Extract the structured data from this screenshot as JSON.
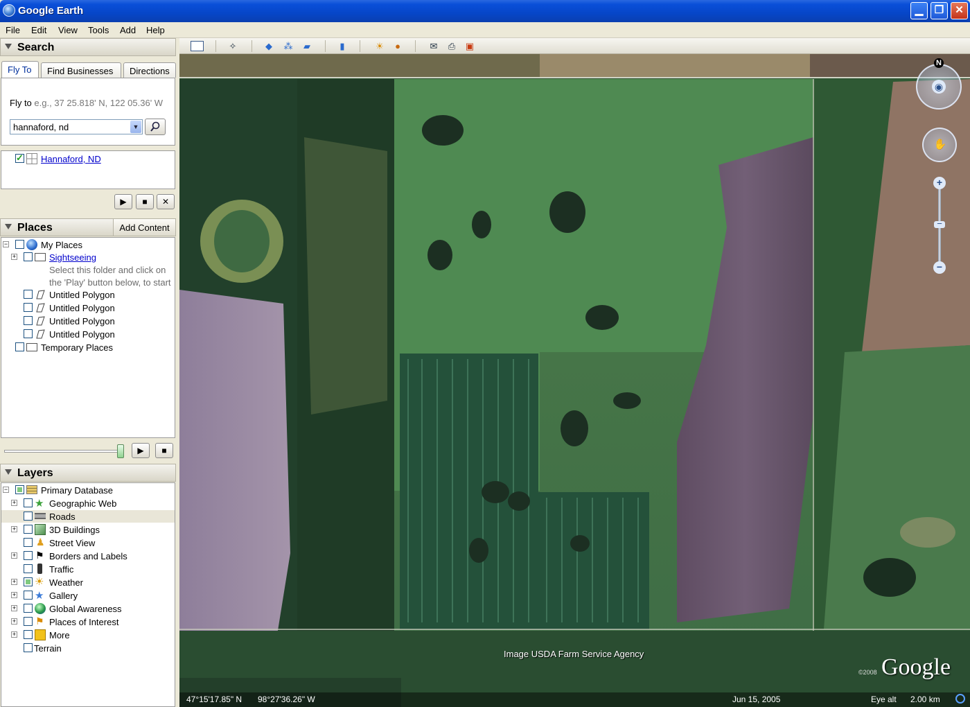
{
  "window": {
    "title": "Google Earth"
  },
  "menu": [
    "File",
    "Edit",
    "View",
    "Tools",
    "Add",
    "Help"
  ],
  "search": {
    "title": "Search",
    "tabs": [
      "Fly To",
      "Find Businesses",
      "Directions"
    ],
    "fly_to_label": "Fly to",
    "fly_to_hint": "e.g., 37 25.818' N, 122 05.36' W",
    "input_value": "hannaford, nd",
    "result": "Hannaford, ND"
  },
  "places": {
    "title": "Places",
    "add_content": "Add Content",
    "items": {
      "my_places": "My Places",
      "sightseeing": "Sightseeing",
      "hint": "Select this folder and click on the 'Play' button below, to start",
      "polygon": "Untitled Polygon",
      "temporary": "Temporary Places"
    }
  },
  "layers": {
    "title": "Layers",
    "items": [
      "Primary Database",
      "Geographic Web",
      "Roads",
      "3D Buildings",
      "Street View",
      "Borders and Labels",
      "Traffic",
      "Weather",
      "Gallery",
      "Global Awareness",
      "Places of Interest",
      "More",
      "Terrain"
    ]
  },
  "map": {
    "attribution": "Image USDA Farm Service Agency",
    "copyright": "©2008",
    "logo": "Google",
    "north": "N",
    "lat": "47°15'17.85\" N",
    "lon": "98°27'36.26\" W",
    "date": "Jun 15, 2005",
    "eye_alt_label": "Eye alt",
    "eye_alt_value": "2.00 km"
  },
  "colors": {
    "titlebar": "#0a4fd8",
    "link": "#0000cc",
    "field_green": "#3a6a3a",
    "field_purple": "#6a5870"
  }
}
